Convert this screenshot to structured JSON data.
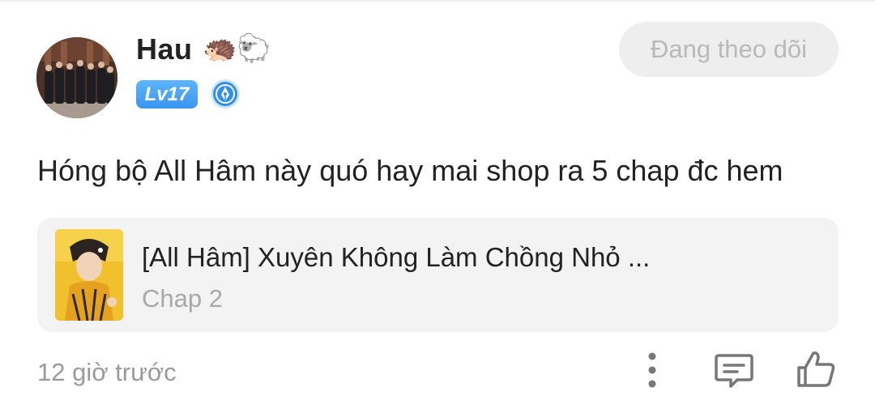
{
  "user": {
    "name": "Hau",
    "emoji": "🦔🐑",
    "level": "Lv17",
    "avatar_icon": "avatar-photo",
    "badge_icon": "author-pen-badge-icon"
  },
  "follow_button": {
    "label": "Đang theo dõi"
  },
  "comment": {
    "text": "Hóng bộ All Hâm này quó hay mai shop ra 5 chap đc hem"
  },
  "story": {
    "title": "[All Hâm] Xuyên Không Làm Chồng Nhỏ ...",
    "chapter": "Chap 2",
    "cover_icon": "story-cover-image"
  },
  "footer": {
    "timestamp": "12 giờ trước",
    "icons": [
      "more-vertical-icon",
      "comment-icon",
      "thumbs-up-icon"
    ]
  },
  "colors": {
    "level_badge": "#3c95f0",
    "follow_bg": "#eeeeee",
    "follow_text": "#b9b9b9",
    "card_bg": "#f3f3f3",
    "text_primary": "#222222",
    "text_secondary": "#9a9a9a"
  }
}
